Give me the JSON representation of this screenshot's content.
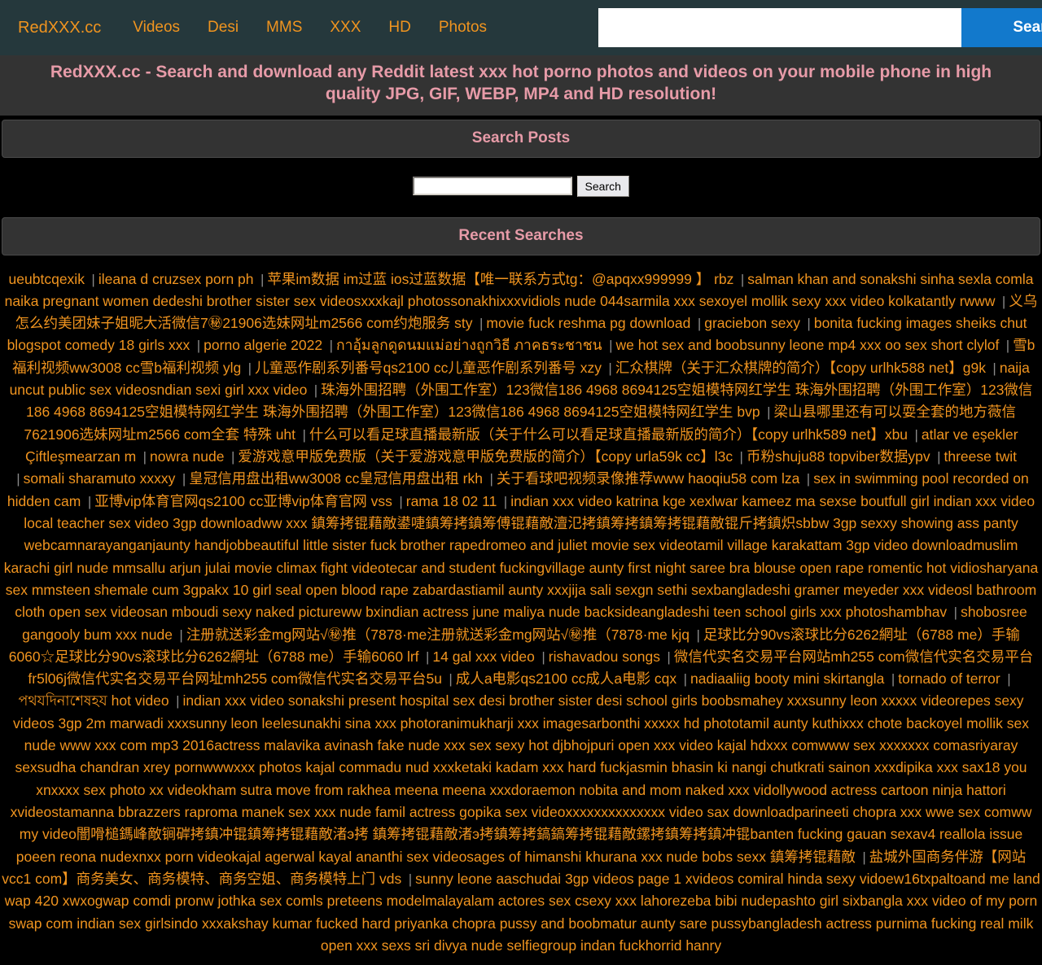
{
  "navbar": {
    "brand": "RedXXX.cc",
    "links": [
      {
        "label": "Videos"
      },
      {
        "label": "Desi"
      },
      {
        "label": "MMS"
      },
      {
        "label": "XXX"
      },
      {
        "label": "HD"
      },
      {
        "label": "Photos"
      }
    ],
    "search_value": "",
    "search_placeholder": "",
    "search_button": "Search",
    "bg_color": "#25383c",
    "link_color": "#f0941f",
    "button_color": "#1279cc"
  },
  "tagline": "RedXXX.cc - Search and download any Reddit latest xxx hot porno photos and videos on your mobile phone in high quality JPG, GIF, WEBP, MP4 and HD resolution!",
  "tagline_color": "#e79ba8",
  "search_posts": {
    "heading": "Search Posts",
    "input_value": "",
    "input_placeholder": "",
    "button_label": "Search"
  },
  "recent_searches": {
    "heading": "Recent Searches",
    "terms": [
      "ueubtcqexik",
      "ileana d cruzsex porn ph",
      "苹果im数据 im过蓝 ios过蓝数据【唯一联系方式tg：@apqxx999999 】 rbz",
      "salman khan and sonakshi sinha sexla comla naika pregnant women dedeshi brother sister sex videosxxxkajl photossonakhixxxvidiols nude 044sarmila xxx sexoyel mollik sexy xxx video kolkatantly rwww",
      "义乌怎么约美团妹子姐昵大活微信7㊙21906选妹网址m2566 com约炮服务 sty",
      "movie fuck reshma pg download",
      "graciebon sexy",
      "bonita fucking images sheiks chut blogspot comedy 18 girls xxx",
      "porno algerie 2022",
      "กาอุ้มลูกดูดนมแม่อย่างถูกวิธี ภาคธระชาชน",
      "we hot sex and boobsunny leone mp4 xxx oo sex short clylof",
      "雪b福利视频ww3008 cc雪b福利视频 ylg",
      "儿童恶作剧系列番号qs2100 cc儿童恶作剧系列番号 xzy",
      "汇众棋牌（关于汇众棋牌的简介）【copy urlhk588 net】g9k",
      "naija uncut public sex videosndian sexi girl xxx video",
      "珠海外围招聘（外围工作室）123微信186 4968 8694125空姐模特网红学生 珠海外围招聘（外围工作室）123微信186 4968 8694125空姐模特网红学生 珠海外围招聘（外围工作室）123微信186 4968 8694125空姐模特网红学生 bvp",
      "梁山县哪里还有可以耍全套的地方薇信7621906选妹网址m2566 com全套 特殊 uht",
      "什么可以看足球直播最新版（关于什么可以看足球直播最新版的简介）【copy urlhk589 net】xbu",
      "atlar ve eşekler Çiftleşmearzan m",
      "nowra nude",
      "爱游戏意甲版免费版（关于爱游戏意甲版免费版的简介）【copy urla59k cc】l3c",
      "币粉shuju88 topviber数据ypv",
      "threese twit",
      "somali sharamuto xxxxy",
      "皇冠信用盘出租ww3008 cc皇冠信用盘出租 rkh",
      "关于看球吧视频录像推荐www haoqiu58 com lza",
      "sex in swimming pool recorded on hidden cam",
      "亚博vip体育官网qs2100 cc亚博vip体育官网 vss",
      "rama 18 02 11",
      "indian xxx video katrina kge xexlwar kameez ma sexse boutfull girl indian xxx video local teacher sex video 3gp downloadww xxx 鎮筹拷锟藉敵鍙啑鎮筹拷鎮筹傅锟藉敵澶氾拷鎮筹拷鎮筹拷锟藉敵锟斤拷鎮炽sbbw 3gp sexxy showing ass panty webcamnarayanganjaunty handjobbeautiful little sister fuck brother rapedromeo and juliet movie sex videotamil village karakattam 3gp video downloadmuslim karachi girl nude mmsallu arjun julai movie climax fight videotecar and student fuckingvillage aunty first night saree bra blouse open rape romentic hot vidiosharyana sex mmsteen shemale cum 3gpakx 10 girl seal open blood rape zabardastiamil aunty xxxjija sali sexgn sethi sexbangladeshi gramer meyeder xxx videosl bathroom cloth open sex videosan mboudi sexy naked pictureww bxindian actress june maliya nude backsideangladeshi teen school girls xxx photoshambhav",
      "shobosree gangooly bum xxx nude",
      "注册就送彩金mg网站√㊙推（7878·me注册就送彩金mg网站√㊙推（7878·me kjq",
      "足球比分90vs滚球比分6262網址（6788 me）手输6060☆足球比分90vs滚球比分6262網址（6788 me）手输6060 lrf",
      "14 gal xxx video",
      "rishavadou songs",
      "微信代实名交易平台网站mh255 com微信代实名交易平台fr5l06j微信代实名交易平台网址mh255 com微信代实名交易平台5u",
      "成人a电影qs2100 cc成人a电影 cqx",
      "nadiaaliig booty mini skirtangla",
      "tornado of terror",
      "পথযদিনাশেষহয hot video",
      "indian xxx video sonakshi present hospital sex desi brother sister desi school girls boobsmahey xxxsunny leon xxxxx videorepes sexy videos 3gp 2m marwadi xxxsunny leon leelesunakhi sina xxx photoranimukharji xxx imagesarbonthi xxxxx hd phototamil aunty kuthixxx chote backoyel mollik sex nude www xxx com mp3 2016actress malavika avinash fake nude xxx sex sexy hot djbhojpuri open xxx video kajal hdxxx comwww sex xxxxxxx comasriyaray sexsudha chandran xrey pornwwwxxx photos kajal commadu nud xxxketaki kadam xxx hard fuckjasmin bhasin ki nangi chutkrati sainon xxxdipika xxx sax18 you xnxxxx sex photo xx videokham sutra move from rakhea meena meena xxxdoraemon nobita and mom naked xxx vidollywood actress cartoon ninja hattori xvideostamanna bbrazzers raproma manek sex xxx nude famil actress gopika sex videoxxxxxxxxxxxxxx video sax downloadparineeti chopra xxx wwe sex comww my video闇嗗槌鎷峰敵锏硸拷鎮冲锟鎮筹拷锟藉敵渚э拷 鎮筹拷锟藉敵渚э拷鎮筹拷鎬鎬筹拷锟藉敵鏍拷鎮筹拷鎮冲锟banten fucking gauan sexav4 reallola issue poeen reona nudexnxx porn videokajal agerwal kayal ananthi sex videosages of himanshi khurana xxx nude bobs sexx 鎮筹拷锟藉敵",
      "盐城外国商务伴游【网站vcc1 com】商务美女、商务模特、商务空姐、商务模特上门 vds",
      "sunny leone aaschudai 3gp videos page 1 xvideos comiral hinda sexy vidoew16txpaltoand me land wap 420 xwxogwap comdi pronw jothka sex comls preteens modelmalayalam actores sex csexy xxx lahorezeba bibi nudepashto girl sixbangla xxx video of my porn swap com indian sex girlsindo xxxakshay kumar fucked hard priyanka chopra pussy and boobmatur aunty sare pussybangladesh actress purnima fucking real milk open xxx sexs sri divya nude selfiegroup indan fuckhorrid hanry"
    ]
  }
}
